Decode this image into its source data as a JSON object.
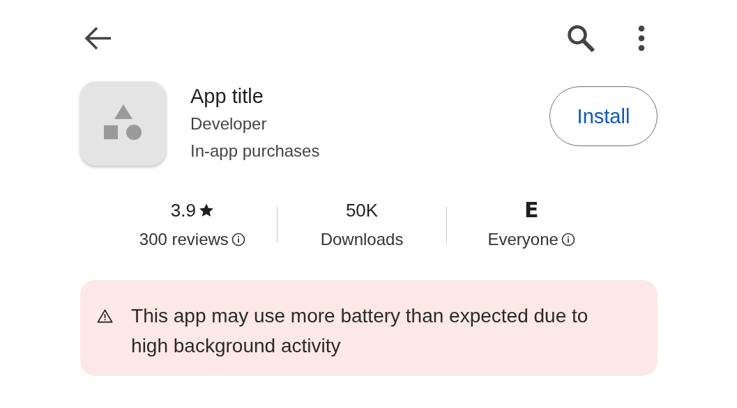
{
  "app": {
    "title": "App title",
    "developer": "Developer",
    "note": "In-app purchases"
  },
  "install_button": "Install",
  "stats": [
    {
      "kind": "rating",
      "value": "3.9",
      "label": "300 reviews",
      "info": true
    },
    {
      "kind": "count",
      "value": "50K",
      "label": "Downloads",
      "info": false
    },
    {
      "kind": "badge",
      "value": "E",
      "label": "Everyone",
      "info": true
    }
  ],
  "warning": "This app may use more battery than expected due to high background activity"
}
